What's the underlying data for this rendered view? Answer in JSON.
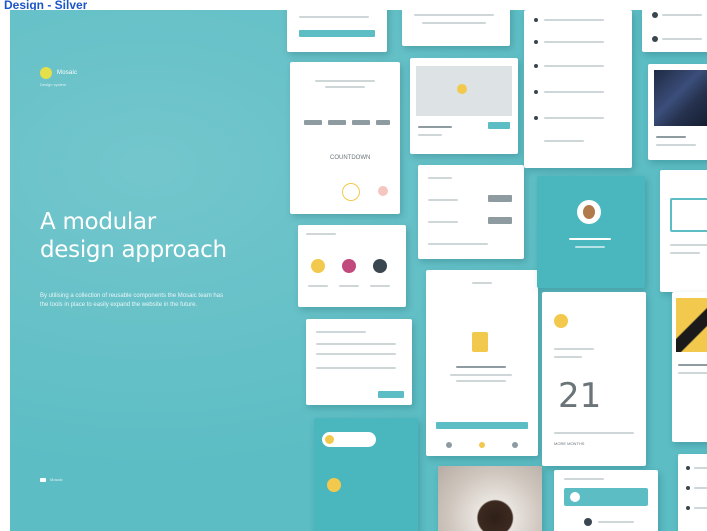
{
  "page": {
    "label": "Design - Silver"
  },
  "hero": {
    "brand_name": "Mosaic",
    "brand_tagline": "Design system",
    "headline": "A modular\ndesign approach",
    "body": "By utilising a collection of reusable components the Mosaic team has the tools in place to easily expand the website in the future."
  },
  "cards": {
    "countdown_label": "COUNTDOWN",
    "calendar_day": "21",
    "calendar_footer": "MORE MONTHS"
  },
  "colors": {
    "background": "#5cbdc4",
    "card": "#ffffff",
    "accent_yellow": "#f2c94c",
    "label_blue": "#1b56c8"
  }
}
